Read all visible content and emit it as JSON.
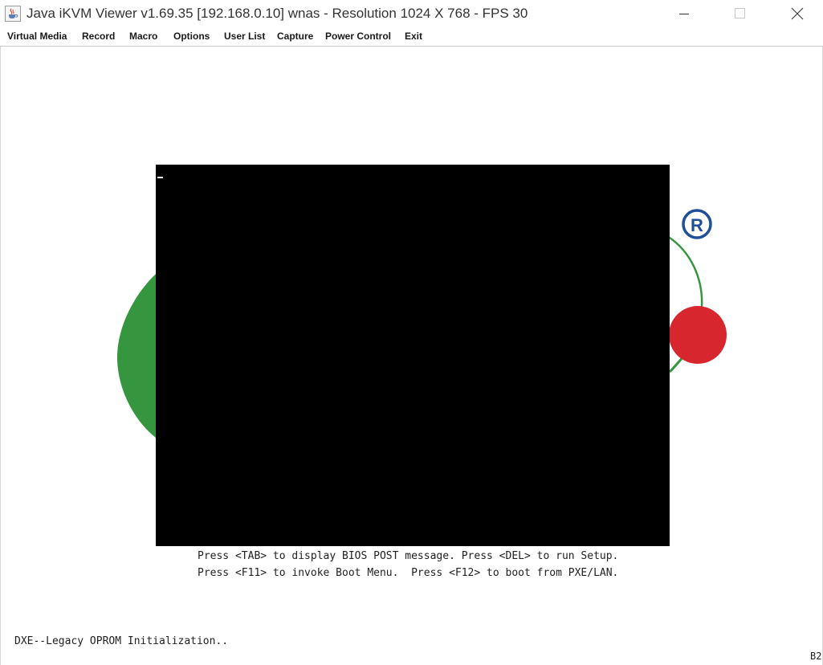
{
  "window": {
    "title": "Java iKVM Viewer v1.69.35 [192.168.0.10] wnas - Resolution 1024 X 768 - FPS 30",
    "icon": "java-coffee-cup-icon",
    "controls": [
      "minimize-icon",
      "maximize-icon",
      "close-icon"
    ]
  },
  "menu": {
    "items": [
      "Virtual Media",
      "Record",
      "Macro",
      "Options",
      "User List",
      "Capture",
      "Power Control",
      "Exit"
    ]
  },
  "screen": {
    "logo": {
      "registered_mark": "®",
      "colors": {
        "green": "#35963f",
        "red": "#d7262e",
        "blue": "#1f4e9a"
      }
    },
    "post_messages": [
      "Press <TAB> to display BIOS POST message. Press <DEL> to run Setup.",
      "Press <F11> to invoke Boot Menu.  Press <F12> to boot from PXE/LAN."
    ],
    "status": "DXE--Legacy OPROM Initialization..",
    "corner_code": "B2"
  }
}
